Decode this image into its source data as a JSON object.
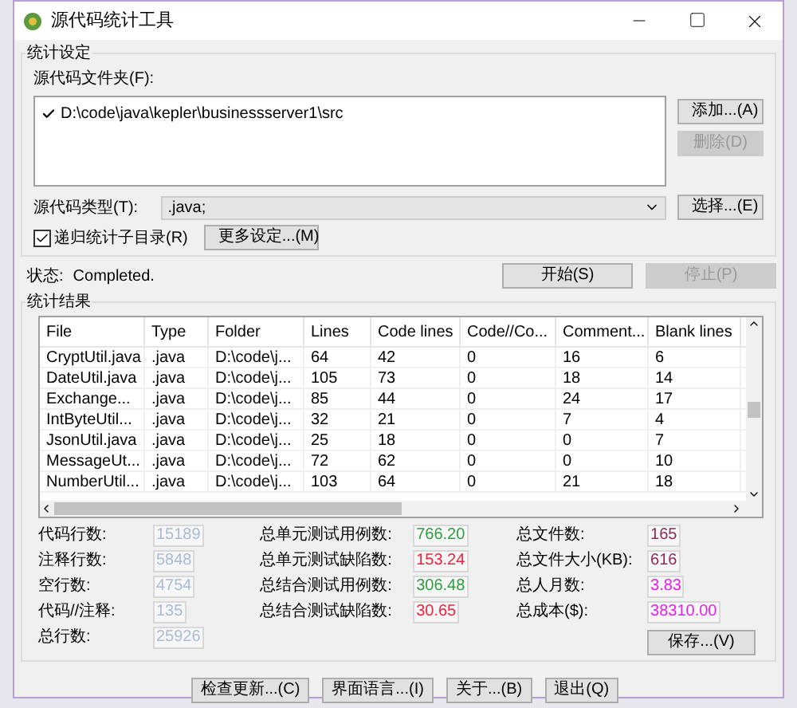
{
  "window": {
    "title": "源代码统计工具"
  },
  "settings": {
    "title": "统计设定",
    "folder_label": "源代码文件夹(F):",
    "folders": [
      {
        "path": "D:\\code\\java\\kepler\\businessserver1\\src",
        "checked": true
      }
    ],
    "folder_buttons": [
      {
        "label": "添加...(A)",
        "disabled": false
      },
      {
        "label": "删除(D)",
        "disabled": true
      }
    ],
    "type_label": "源代码类型(T):",
    "type_value": ".java;",
    "choose_button": "选择...(E)",
    "recursive": {
      "label": "递归统计子目录(R)",
      "checked": true
    },
    "more_button": "更多设定...(M)"
  },
  "status": {
    "label": "状态:",
    "value": "Completed."
  },
  "actions": [
    {
      "label": "开始(S)",
      "disabled": false
    },
    {
      "label": "停止(P)",
      "disabled": true
    }
  ],
  "results": {
    "title": "统计结果",
    "table": {
      "columns": [
        "File",
        "Type",
        "Folder",
        "Lines",
        "Code lines",
        "Code//Co...",
        "Comment...",
        "Blank lines"
      ],
      "rows": [
        [
          "CryptUtil.java",
          ".java",
          "D:\\code\\j...",
          "64",
          "42",
          "0",
          "16",
          "6"
        ],
        [
          "DateUtil.java",
          ".java",
          "D:\\code\\j...",
          "105",
          "73",
          "0",
          "18",
          "14"
        ],
        [
          "Exchange...",
          ".java",
          "D:\\code\\j...",
          "85",
          "44",
          "0",
          "24",
          "17"
        ],
        [
          "IntByteUtil...",
          ".java",
          "D:\\code\\j...",
          "32",
          "21",
          "0",
          "7",
          "4"
        ],
        [
          "JsonUtil.java",
          ".java",
          "D:\\code\\j...",
          "25",
          "18",
          "0",
          "0",
          "7"
        ],
        [
          "MessageUt...",
          ".java",
          "D:\\code\\j...",
          "72",
          "62",
          "0",
          "0",
          "10"
        ],
        [
          "NumberUtil...",
          ".java",
          "D:\\code\\j...",
          "103",
          "64",
          "0",
          "21",
          "18"
        ]
      ]
    },
    "stats": [
      [
        {
          "label": "代码行数:",
          "value": "15189",
          "color": "#a9bcd6"
        },
        {
          "label": "注释行数:",
          "value": "5848",
          "color": "#a9bcd6"
        },
        {
          "label": "空行数:",
          "value": "4754",
          "color": "#a9bcd6"
        },
        {
          "label": "代码//注释:",
          "value": "135",
          "color": "#a9bcd6"
        },
        {
          "label": "总行数:",
          "value": "25926",
          "color": "#a9bcd6"
        }
      ],
      [
        {
          "label": "总单元测试用例数:",
          "value": "766.20",
          "color": "#2e9e3e"
        },
        {
          "label": "总单元测试缺陷数:",
          "value": "153.24",
          "color": "#f0243c"
        },
        {
          "label": "总结合测试用例数:",
          "value": "306.48",
          "color": "#2e9e3e"
        },
        {
          "label": "总结合测试缺陷数:",
          "value": "30.65",
          "color": "#f0243c"
        }
      ],
      [
        {
          "label": "总文件数:",
          "value": "165",
          "color": "#8e2a5a"
        },
        {
          "label": "总文件大小(KB):",
          "value": "616",
          "color": "#8e2a5a"
        },
        {
          "label": "总人月数:",
          "value": "3.83",
          "color": "#e81fe8"
        },
        {
          "label": "总成本($):",
          "value": "38310.00",
          "color": "#e81fe8"
        }
      ]
    ],
    "save_button": "保存...(V)"
  },
  "bottom_buttons": [
    "检查更新...(C)",
    "界面语言...(I)",
    "关于...(B)",
    "退出(Q)"
  ]
}
